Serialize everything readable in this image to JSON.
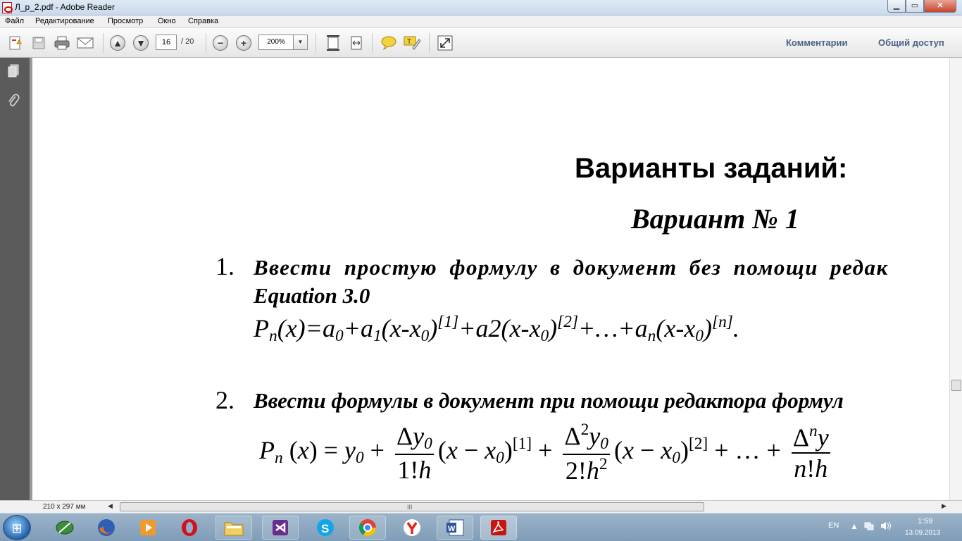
{
  "window": {
    "title": "Л_р_2.pdf - Adobe Reader",
    "min_glyph": "▁",
    "max_glyph": "▭",
    "close_glyph": "✕"
  },
  "menu": [
    "Файл",
    "Редактирование",
    "Просмотр",
    "Окно",
    "Справка"
  ],
  "toolbar": {
    "current_page": "16",
    "total_pages": "/ 20",
    "zoom": "200%",
    "zoom_arrow": "▼",
    "icons": [
      "create-pdf-icon",
      "save-icon",
      "print-icon",
      "email-icon",
      "previous-page-icon",
      "next-page-icon",
      "zoom-out-icon",
      "zoom-in-icon",
      "fit-page-icon",
      "fit-width-icon",
      "comment-icon",
      "highlight-icon",
      "full-screen-icon"
    ],
    "comments_label": "Комментарии",
    "share_label": "Общий доступ"
  },
  "document": {
    "heading": "Варианты заданий:",
    "variant": "Вариант № 1",
    "item1_num": "1.",
    "item1_line1": "Ввести простую формулу в документ без помощи редак",
    "item1_line2": "Equation 3.0",
    "item2_num": "2.",
    "item2_text": "Ввести формулы в документ при помощи редактора формул"
  },
  "status": {
    "page_size": "210 x 297 мм",
    "scroll_left": "◀",
    "scroll_right": "▶",
    "grip": "III"
  },
  "taskbar": {
    "apps": [
      "windows-start",
      "media-center",
      "firefox",
      "media-player",
      "opera",
      "file-explorer",
      "visual-studio",
      "skype",
      "chrome",
      "yandex-browser",
      "word",
      "adobe-reader"
    ],
    "language": "EN",
    "time": "1:59",
    "date": "13.09.2013"
  },
  "colors": {
    "accent_link": "#4a6285",
    "nav_pane": "#5b5b5b",
    "close_button": "#c7452e"
  }
}
